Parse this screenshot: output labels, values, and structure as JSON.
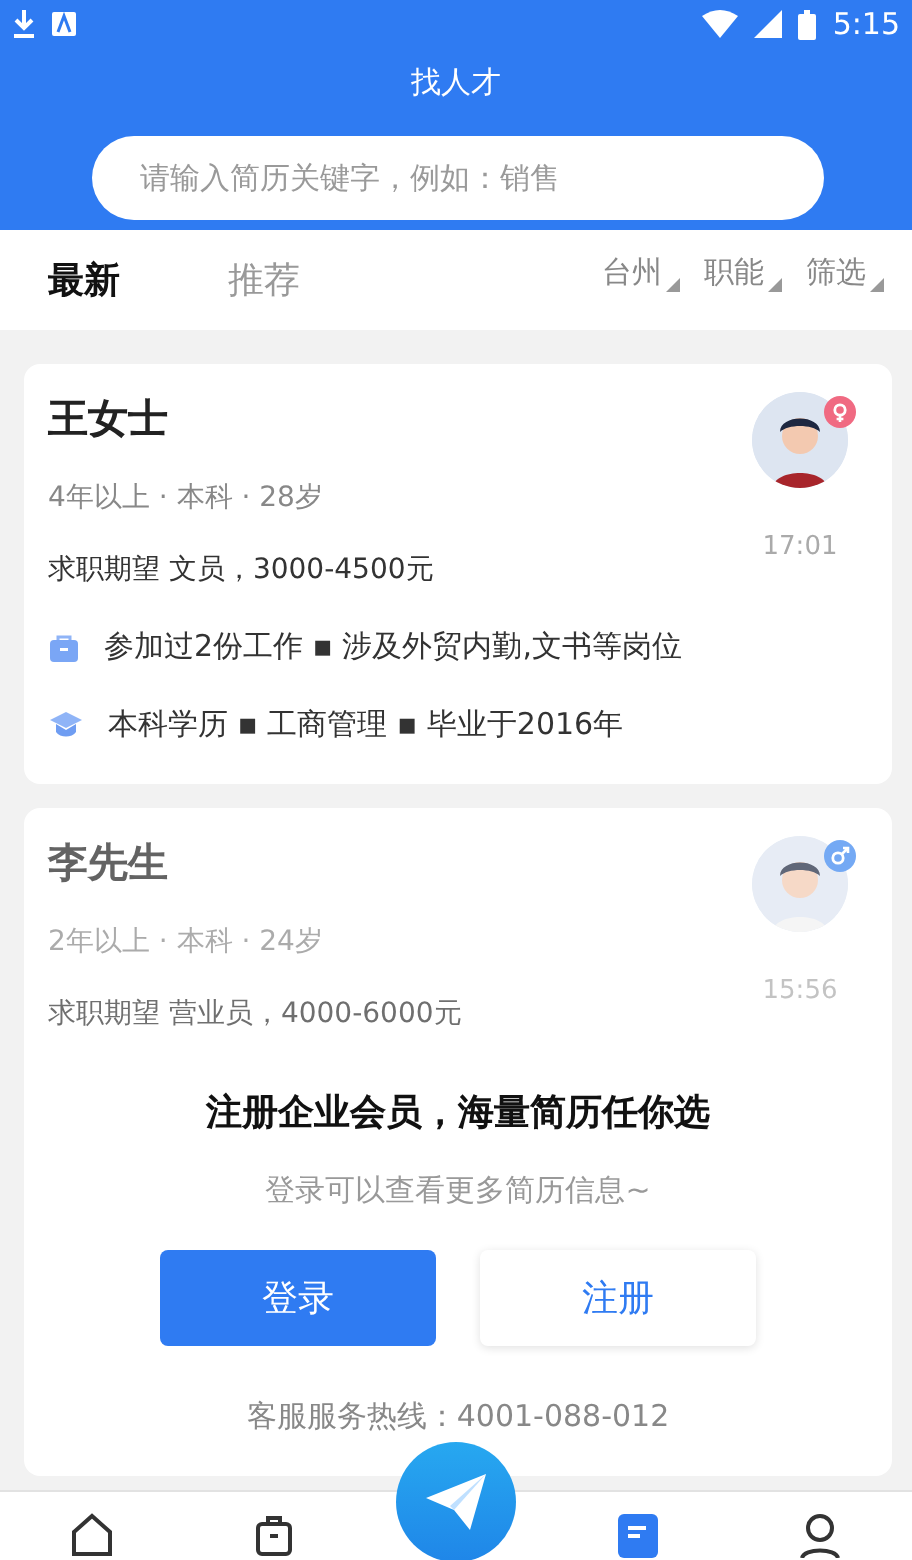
{
  "status_bar": {
    "time": "5:15"
  },
  "header": {
    "title": "找人才"
  },
  "search": {
    "placeholder": "请输入简历关键字，例如：销售"
  },
  "tabs": [
    {
      "label": "最新",
      "selected": true
    },
    {
      "label": "推荐",
      "selected": false
    }
  ],
  "filters": [
    {
      "label": "台州"
    },
    {
      "label": "职能"
    },
    {
      "label": "筛选"
    }
  ],
  "candidates": [
    {
      "name": "王女士",
      "kind": "female",
      "meta": "4年以上 · 本科 · 28岁",
      "time": "17:01",
      "expectation": "求职期望 文员，3000-4500元",
      "faded": false,
      "details": [
        {
          "kind": "work",
          "text": "参加过2份工作 ▪ 涉及外贸内勤,文书等岗位"
        },
        {
          "kind": "education",
          "text": "本科学历 ▪ 工商管理 ▪ 毕业于2016年"
        }
      ]
    },
    {
      "name": "李先生",
      "kind": "male",
      "meta": "2年以上 · 本科 · 24岁",
      "time": "15:56",
      "expectation": "求职期望 营业员，4000-6000元",
      "faded": true
    }
  ],
  "promo": {
    "title": "注册企业会员，海量简历任你选",
    "subtitle": "登录可以查看更多简历信息~",
    "buttons": [
      {
        "label": "登录",
        "kind": "primary"
      },
      {
        "label": "注册",
        "kind": "secondary"
      }
    ],
    "hotline": "客服服务热线：4001-088-012"
  },
  "bottom_nav": [
    {
      "kind": "home",
      "selected": false
    },
    {
      "kind": "bag",
      "selected": false
    },
    {
      "kind": "send",
      "selected": false
    },
    {
      "kind": "resume",
      "selected": true
    },
    {
      "kind": "person",
      "selected": false
    }
  ]
}
